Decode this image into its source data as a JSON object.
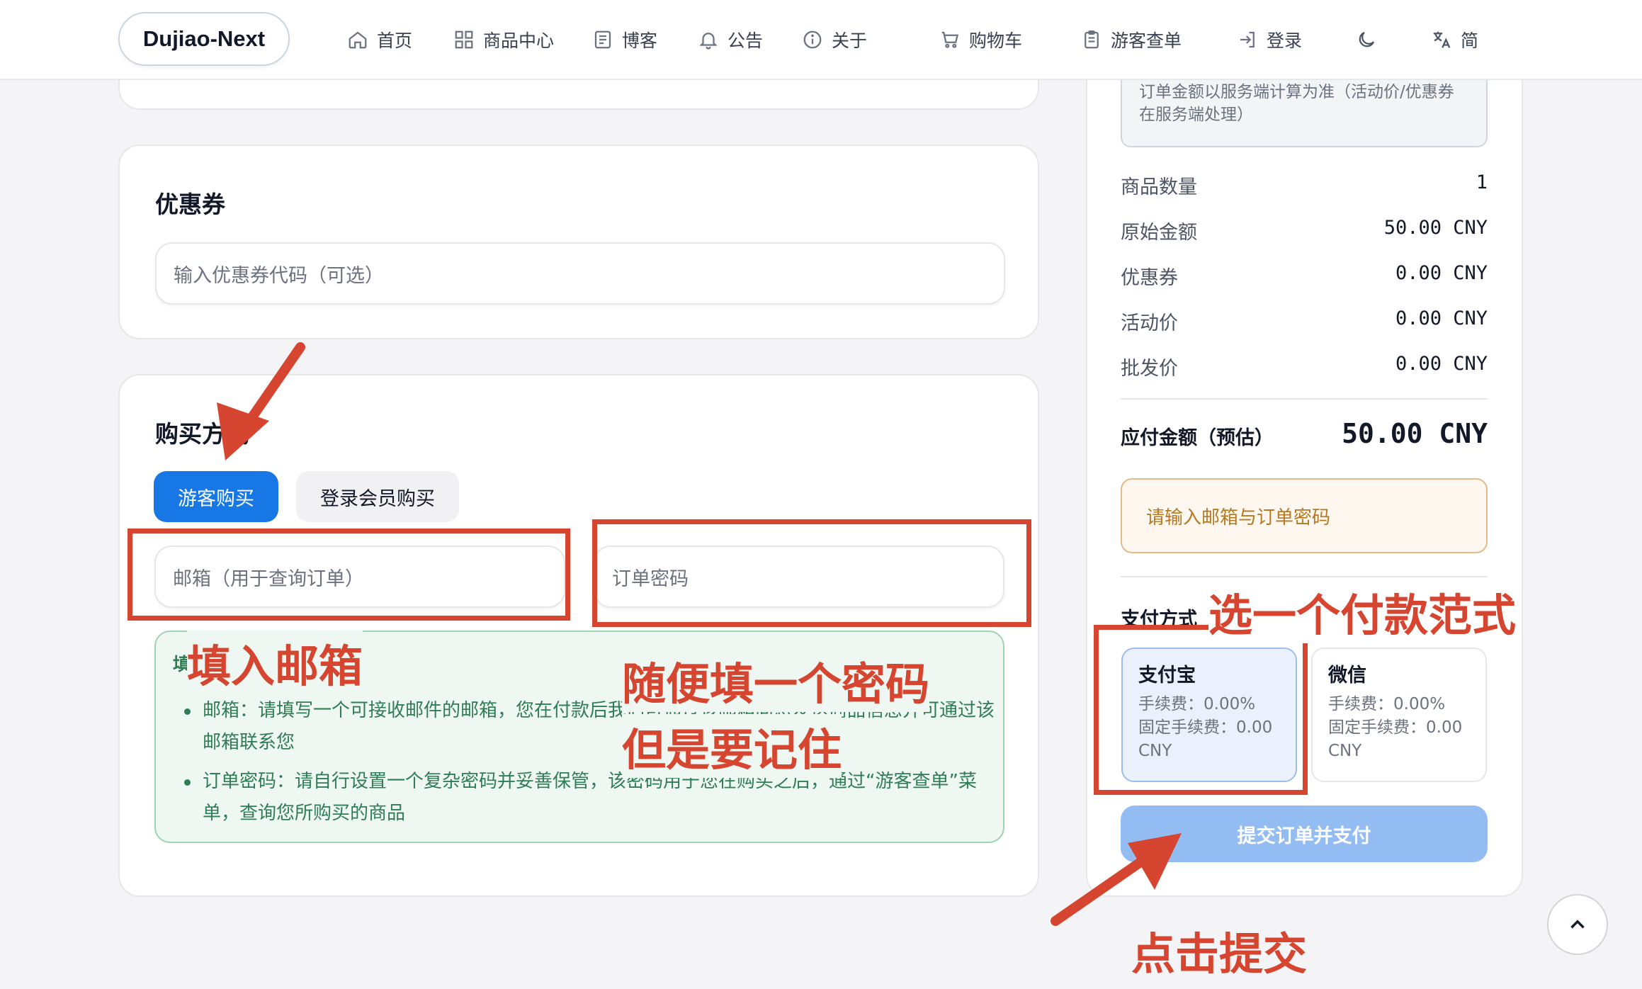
{
  "nav": {
    "logo": "Dujiao-Next",
    "items": [
      {
        "label": "首页",
        "icon": "home-icon"
      },
      {
        "label": "商品中心",
        "icon": "grid-icon"
      },
      {
        "label": "博客",
        "icon": "newspaper-icon"
      },
      {
        "label": "公告",
        "icon": "bell-icon"
      },
      {
        "label": "关于",
        "icon": "info-icon"
      },
      {
        "label": "购物车",
        "icon": "cart-icon"
      },
      {
        "label": "游客查单",
        "icon": "clipboard-icon"
      },
      {
        "label": "登录",
        "icon": "login-icon"
      }
    ],
    "theme_icon": "moon-icon",
    "lang_label": "简",
    "lang_icon": "translate-icon"
  },
  "coupon": {
    "title": "优惠券",
    "placeholder": "输入优惠券代码（可选）"
  },
  "purchase": {
    "title": "购买方式",
    "tabs": [
      "游客购买",
      "登录会员购买"
    ],
    "email_placeholder": "邮箱（用于查询订单）",
    "password_placeholder": "订单密码",
    "info_title": "填写说明",
    "info_items": [
      "邮箱：请填写一个可接收邮件的邮箱，您在付款后我们可通过该邮箱向您发送商品信息并可通过该邮箱联系您",
      "订单密码：请自行设置一个复杂密码并妥善保管，该密码用于您在购买之后，通过“游客查单”菜单，查询您所购买的商品"
    ]
  },
  "summary": {
    "note": "订单金额以服务端计算为准（活动价/优惠券在服务端处理）",
    "rows": [
      {
        "label": "商品数量",
        "value": "1"
      },
      {
        "label": "原始金额",
        "value": "50.00 CNY"
      },
      {
        "label": "优惠券",
        "value": "0.00 CNY"
      },
      {
        "label": "活动价",
        "value": "0.00 CNY"
      },
      {
        "label": "批发价",
        "value": "0.00 CNY"
      }
    ],
    "total_label": "应付金额（预估）",
    "total_value": "50.00 CNY",
    "warning": "请输入邮箱与订单密码",
    "pay_title": "支付方式",
    "pay_methods": [
      {
        "name": "支付宝",
        "fee": "手续费：0.00%",
        "fixed": "固定手续费：0.00 CNY"
      },
      {
        "name": "微信",
        "fee": "手续费：0.00%",
        "fixed": "固定手续费：0.00 CNY"
      }
    ],
    "submit_label": "提交订单并支付"
  },
  "annotations": {
    "fill_email": "填入邮箱",
    "password_1": "随便填一个密码",
    "password_2": "但是要记住",
    "choose_pay": "选一个付款范式",
    "click_submit": "点击提交"
  },
  "colors": {
    "primary": "#1677e5",
    "annotation": "#d6452f",
    "warning_text": "#b7791f",
    "info_green": "#2f7d55"
  }
}
